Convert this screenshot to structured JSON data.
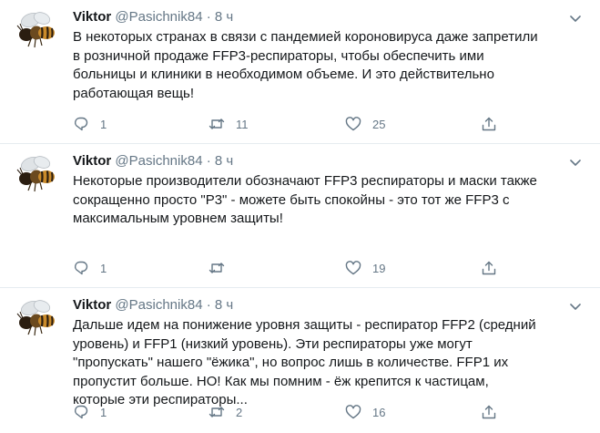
{
  "tweets": [
    {
      "name": "Viktor",
      "handle": "@Pasichnik84",
      "separator": "·",
      "time": "8 ч",
      "text": "В некоторых странах в связи с пандемией короновируса даже запретили\nв розничной продаже FFP3-респираторы, чтобы обеспечить ими\nбольницы и клиники в необходимом объеме. И это действительно\nработающая вещь!",
      "replies": "1",
      "retweets": "11",
      "likes": "25"
    },
    {
      "name": "Viktor",
      "handle": "@Pasichnik84",
      "separator": "·",
      "time": "8 ч",
      "text": "Некоторые производители обозначают FFP3 респираторы и маски также\nсокращенно просто \"Р3\" - можете быть спокойны - это тот же FFP3 с\nмаксимальным уровнем защиты!",
      "replies": "1",
      "retweets": "",
      "likes": "19"
    },
    {
      "name": "Viktor",
      "handle": "@Pasichnik84",
      "separator": "·",
      "time": "8 ч",
      "text": "Дальше идем на понижение уровня защиты - респиратор FFP2 (средний\nуровень) и FFP1 (низкий уровень). Эти респираторы уже могут\n\"пропускать\" нашего \"ёжика\", но вопрос лишь в количестве. FFP1 их\nпропустит больше. НО! Как мы помним - ёж крепится к частицам,\nкоторые эти респираторы...",
      "replies": "1",
      "retweets": "2",
      "likes": "16"
    }
  ],
  "icons": {
    "avatar": "bee-photo",
    "caret": "chevron-down-icon",
    "reply": "reply-icon",
    "retweet": "retweet-icon",
    "like": "heart-icon",
    "share": "share-icon"
  },
  "colors": {
    "text": "#14171a",
    "secondary": "#657786",
    "divider": "#e6ecf0"
  }
}
